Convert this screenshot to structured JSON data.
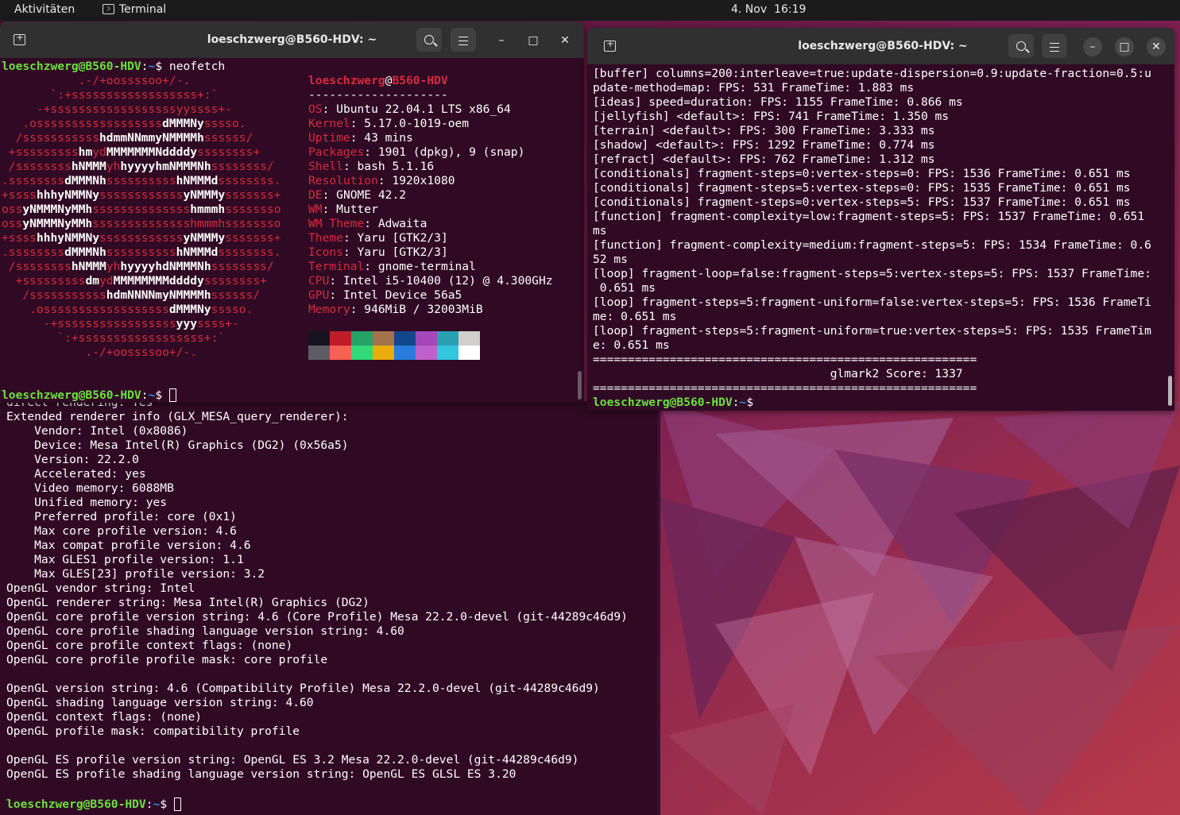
{
  "topbar": {
    "activities": "Aktivitäten",
    "app_name": "Terminal",
    "clock": "4. Nov  16:19"
  },
  "window_title": "loeschzwerg@B560-HDV: ~",
  "prompt": {
    "user_host": "loeschzwerg@B560-HDV",
    "path": "~",
    "symbol": "$"
  },
  "glxinfo_lines": [
    "direct rendering: Yes",
    "Extended renderer info (GLX_MESA_query_renderer):",
    "    Vendor: Intel (0x8086)",
    "    Device: Mesa Intel(R) Graphics (DG2) (0x56a5)",
    "    Version: 22.2.0",
    "    Accelerated: yes",
    "    Video memory: 6088MB",
    "    Unified memory: yes",
    "    Preferred profile: core (0x1)",
    "    Max core profile version: 4.6",
    "    Max compat profile version: 4.6",
    "    Max GLES1 profile version: 1.1",
    "    Max GLES[23] profile version: 3.2",
    "OpenGL vendor string: Intel",
    "OpenGL renderer string: Mesa Intel(R) Graphics (DG2)",
    "OpenGL core profile version string: 4.6 (Core Profile) Mesa 22.2.0-devel (git-44289c46d9)",
    "OpenGL core profile shading language version string: 4.60",
    "OpenGL core profile context flags: (none)",
    "OpenGL core profile profile mask: core profile",
    "",
    "OpenGL version string: 4.6 (Compatibility Profile) Mesa 22.2.0-devel (git-44289c46d9)",
    "OpenGL shading language version string: 4.60",
    "OpenGL context flags: (none)",
    "OpenGL profile mask: compatibility profile",
    "",
    "OpenGL ES profile version string: OpenGL ES 3.2 Mesa 22.2.0-devel (git-44289c46d9)",
    "OpenGL ES profile shading language version string: OpenGL ES GLSL ES 3.20"
  ],
  "neofetch": {
    "command": "neofetch",
    "logo_lines": [
      [
        [
          "           .-/+oossssoo+/-.",
          "r"
        ]
      ],
      [
        [
          "       `:+ssssssssssssssssss+:`",
          "r"
        ]
      ],
      [
        [
          "     -+ssssssssssssssssssyyssss+-",
          "r"
        ]
      ],
      [
        [
          "   .ossssssssssssssssss",
          "r"
        ],
        [
          "dMMMNy",
          "w"
        ],
        [
          "sssso.",
          "r"
        ]
      ],
      [
        [
          "  /sssssssssss",
          "r"
        ],
        [
          "hdmmNNmmyNMMMMh",
          "w"
        ],
        [
          "ssssss/",
          "r"
        ]
      ],
      [
        [
          " +sssssssss",
          "r"
        ],
        [
          "hm",
          "w"
        ],
        [
          "yd",
          "r"
        ],
        [
          "MMMMMMMNddddy",
          "w"
        ],
        [
          "ssssssss+",
          "r"
        ]
      ],
      [
        [
          " /ssssssss",
          "r"
        ],
        [
          "hNMMM",
          "w"
        ],
        [
          "yh",
          "r"
        ],
        [
          "hyyyyhmNMMMNh",
          "w"
        ],
        [
          "ssssssss/",
          "r"
        ]
      ],
      [
        [
          ".ssssssss",
          "r"
        ],
        [
          "dMMMNh",
          "w"
        ],
        [
          "ssssssssss",
          "r"
        ],
        [
          "hNMMMd",
          "w"
        ],
        [
          "ssssssss.",
          "r"
        ]
      ],
      [
        [
          "+ssss",
          "r"
        ],
        [
          "hhhyNMMNy",
          "w"
        ],
        [
          "ssssssssssss",
          "r"
        ],
        [
          "yNMMMy",
          "w"
        ],
        [
          "sssssss+",
          "r"
        ]
      ],
      [
        [
          "oss",
          "r"
        ],
        [
          "yNMMMNyMMh",
          "w"
        ],
        [
          "ssssssssssssss",
          "r"
        ],
        [
          "hmmmh",
          "w"
        ],
        [
          "ssssssso",
          "r"
        ]
      ],
      [
        [
          "oss",
          "r"
        ],
        [
          "yNMMMNyMMh",
          "w"
        ],
        [
          "sssssssssssssshmmmhssssssso",
          "r"
        ]
      ],
      [
        [
          "+ssss",
          "r"
        ],
        [
          "hhhyNMMNy",
          "w"
        ],
        [
          "ssssssssssss",
          "r"
        ],
        [
          "yNMMMy",
          "w"
        ],
        [
          "sssssss+",
          "r"
        ]
      ],
      [
        [
          ".ssssssss",
          "r"
        ],
        [
          "dMMMNh",
          "w"
        ],
        [
          "ssssssssss",
          "r"
        ],
        [
          "hNMMMd",
          "w"
        ],
        [
          "ssssssss.",
          "r"
        ]
      ],
      [
        [
          " /ssssssss",
          "r"
        ],
        [
          "hNMMM",
          "w"
        ],
        [
          "yh",
          "r"
        ],
        [
          "hyyyyhdNMMMNh",
          "w"
        ],
        [
          "ssssssss/",
          "r"
        ]
      ],
      [
        [
          "  +sssssssss",
          "r"
        ],
        [
          "dm",
          "w"
        ],
        [
          "yd",
          "r"
        ],
        [
          "MMMMMMMMddddy",
          "w"
        ],
        [
          "ssssssss+",
          "r"
        ]
      ],
      [
        [
          "   /sssssssssss",
          "r"
        ],
        [
          "hdmNNNNmyNMMMMh",
          "w"
        ],
        [
          "ssssss/",
          "r"
        ]
      ],
      [
        [
          "    .ossssssssssssssssss",
          "r"
        ],
        [
          "dMMMNy",
          "w"
        ],
        [
          "sssso.",
          "r"
        ]
      ],
      [
        [
          "      -+sssssssssssssssss",
          "r"
        ],
        [
          "yyy",
          "w"
        ],
        [
          "ssss+-",
          "r"
        ]
      ],
      [
        [
          "        `:+ssssssssssssssssss+:`",
          "r"
        ]
      ],
      [
        [
          "            .-/+oossssoo+/-.",
          "r"
        ]
      ]
    ],
    "header_user": "loeschzwerg",
    "header_at": "@",
    "header_host": "B560-HDV",
    "separator": "--------------------",
    "info": [
      {
        "label": "OS",
        "value": "Ubuntu 22.04.1 LTS x86_64"
      },
      {
        "label": "Kernel",
        "value": "5.17.0-1019-oem"
      },
      {
        "label": "Uptime",
        "value": "43 mins"
      },
      {
        "label": "Packages",
        "value": "1901 (dpkg), 9 (snap)"
      },
      {
        "label": "Shell",
        "value": "bash 5.1.16"
      },
      {
        "label": "Resolution",
        "value": "1920x1080"
      },
      {
        "label": "DE",
        "value": "GNOME 42.2"
      },
      {
        "label": "WM",
        "value": "Mutter"
      },
      {
        "label": "WM Theme",
        "value": "Adwaita"
      },
      {
        "label": "Theme",
        "value": "Yaru [GTK2/3]"
      },
      {
        "label": "Icons",
        "value": "Yaru [GTK2/3]"
      },
      {
        "label": "Terminal",
        "value": "gnome-terminal"
      },
      {
        "label": "CPU",
        "value": "Intel i5-10400 (12) @ 4.300GHz"
      },
      {
        "label": "GPU",
        "value": "Intel Device 56a5"
      },
      {
        "label": "Memory",
        "value": "946MiB / 32003MiB"
      }
    ],
    "palette_row1": [
      "#171421",
      "#c01c28",
      "#26a269",
      "#a2734c",
      "#12488b",
      "#a347ba",
      "#2aa1b3",
      "#d0cfcc"
    ],
    "palette_row2": [
      "#5e5c64",
      "#f66151",
      "#33da7a",
      "#e9ad0c",
      "#2a7bde",
      "#c061cb",
      "#33c7de",
      "#ffffff"
    ]
  },
  "glmark_lines": [
    "[buffer] columns=200:interleave=true:update-dispersion=0.9:update-fraction=0.5:u",
    "pdate-method=map: FPS: 531 FrameTime: 1.883 ms",
    "[ideas] speed=duration: FPS: 1155 FrameTime: 0.866 ms",
    "[jellyfish] <default>: FPS: 741 FrameTime: 1.350 ms",
    "[terrain] <default>: FPS: 300 FrameTime: 3.333 ms",
    "[shadow] <default>: FPS: 1292 FrameTime: 0.774 ms",
    "[refract] <default>: FPS: 762 FrameTime: 1.312 ms",
    "[conditionals] fragment-steps=0:vertex-steps=0: FPS: 1536 FrameTime: 0.651 ms",
    "[conditionals] fragment-steps=5:vertex-steps=0: FPS: 1535 FrameTime: 0.651 ms",
    "[conditionals] fragment-steps=0:vertex-steps=5: FPS: 1537 FrameTime: 0.651 ms",
    "[function] fragment-complexity=low:fragment-steps=5: FPS: 1537 FrameTime: 0.651",
    "ms",
    "[function] fragment-complexity=medium:fragment-steps=5: FPS: 1534 FrameTime: 0.6",
    "52 ms",
    "[loop] fragment-loop=false:fragment-steps=5:vertex-steps=5: FPS: 1537 FrameTime:",
    " 0.651 ms",
    "[loop] fragment-steps=5:fragment-uniform=false:vertex-steps=5: FPS: 1536 FrameTi",
    "me: 0.651 ms",
    "[loop] fragment-steps=5:fragment-uniform=true:vertex-steps=5: FPS: 1535 FrameTim",
    "e: 0.651 ms",
    "=======================================================",
    "                                  glmark2 Score: 1337",
    "======================================================="
  ]
}
